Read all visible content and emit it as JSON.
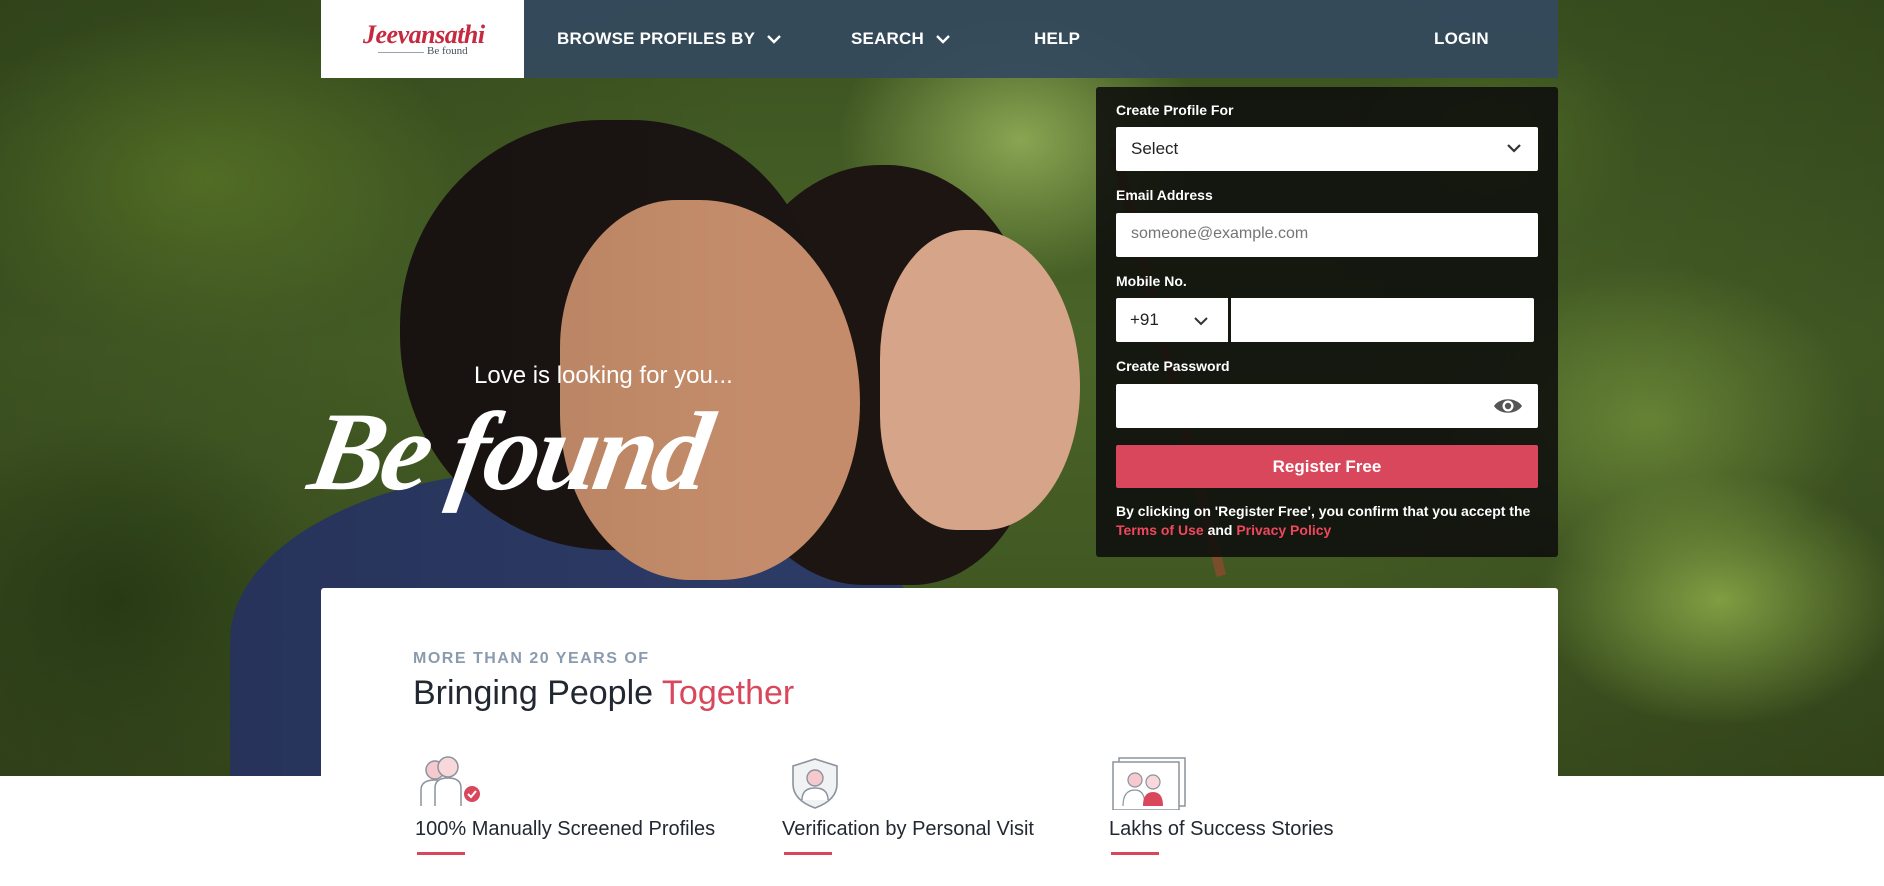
{
  "brand": {
    "logo_main": "Jeevansathi",
    "logo_tagline": "Be found",
    "accent": "#d9475c",
    "nav_bg": "#34495e"
  },
  "nav": {
    "items": [
      {
        "label": "BROWSE PROFILES BY",
        "icon": "chevron-down-icon"
      },
      {
        "label": "SEARCH",
        "icon": "chevron-down-icon"
      },
      {
        "label": "HELP"
      }
    ],
    "login": "LOGIN"
  },
  "hero": {
    "tagline_small": "Love is looking for you...",
    "tagline_big": "Be found"
  },
  "form": {
    "profile_for": {
      "label": "Create Profile For",
      "value": "Select"
    },
    "email": {
      "label": "Email Address",
      "placeholder": "someone@example.com",
      "value": ""
    },
    "mobile": {
      "label": "Mobile No.",
      "country_code": "+91",
      "value": ""
    },
    "password": {
      "label": "Create Password",
      "value": "",
      "icon": "eye-icon"
    },
    "register_label": "Register Free",
    "terms_prefix": "By clicking on 'Register Free', you confirm that you accept the",
    "terms_link": "Terms of Use",
    "terms_and": "and",
    "privacy_link": "Privacy Policy"
  },
  "content": {
    "eyebrow": "MORE THAN 20 YEARS OF",
    "headline_plain": "Bringing People",
    "headline_accent": "Together",
    "features": [
      {
        "title": "100% Manually Screened Profiles",
        "icon": "people-check-icon"
      },
      {
        "title": "Verification by Personal Visit",
        "icon": "shield-person-icon"
      },
      {
        "title": "Lakhs of Success Stories",
        "icon": "photo-frame-couple-icon"
      }
    ]
  }
}
